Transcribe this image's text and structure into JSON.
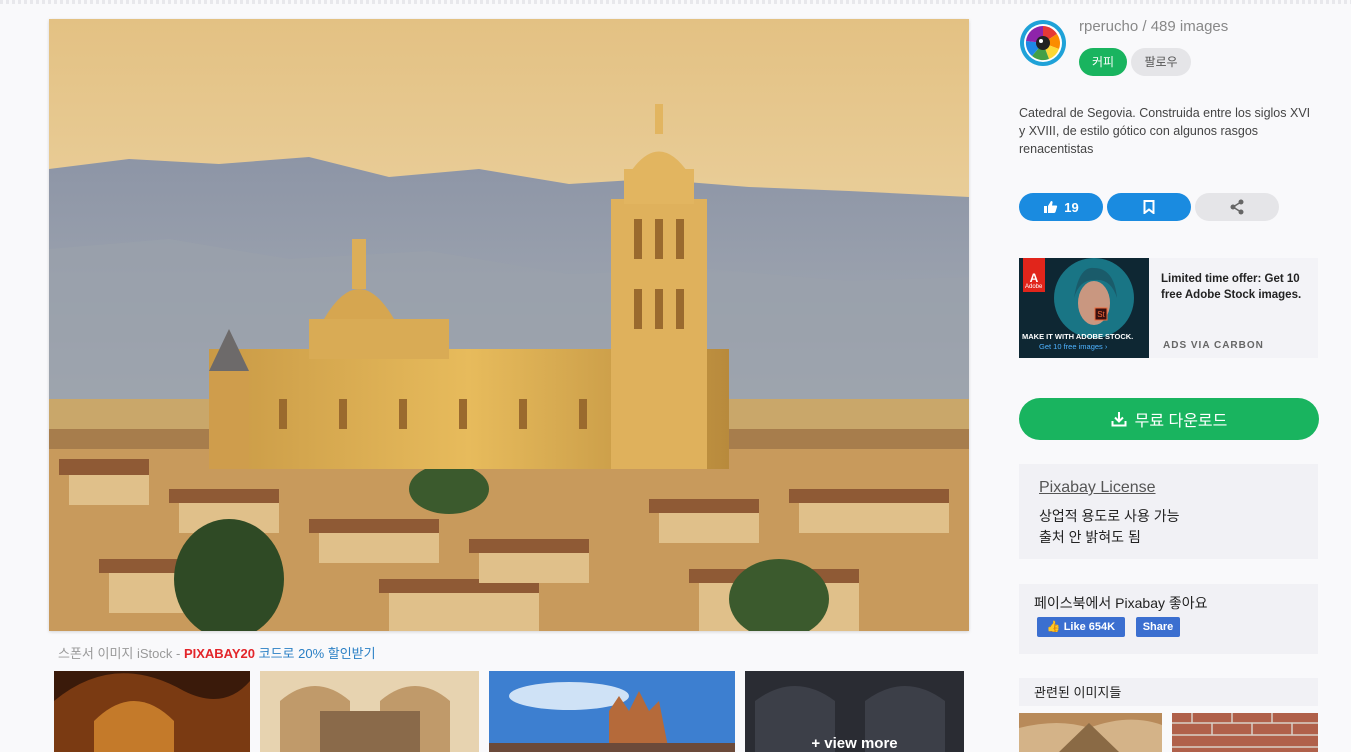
{
  "sponsor": {
    "prefix": "스폰서 이미지 iStock - ",
    "code": "PIXABAY20",
    "suffix": " 코드로 20% 할인받기"
  },
  "thumbnails": {
    "view_more": "+ view more"
  },
  "user": {
    "name_count": "rperucho / 489 images",
    "coffee_label": "커피",
    "follow_label": "팔로우"
  },
  "description": "Catedral de Segovia. Construida entre los siglos XVI y XVIII, de estilo gótico con algunos rasgos renacentistas",
  "actions": {
    "like_count": "19"
  },
  "ad": {
    "headline": "MAKE IT WITH ADOBE STOCK.",
    "cta": "Get 10 free images ›",
    "text": "Limited time offer: Get 10 free Adobe Stock images.",
    "via": "ADS VIA CARBON",
    "brand": "Adobe",
    "app_badge": "St"
  },
  "download": {
    "label": "무료 다운로드"
  },
  "license": {
    "title": "Pixabay License",
    "line1": "상업적 용도로 사용 가능",
    "line2": "출처 안 밝혀도 됨"
  },
  "facebook": {
    "title": "페이스북에서 Pixabay 좋아요",
    "like_label": "Like 654K",
    "share_label": "Share"
  },
  "related": {
    "title": "관련된 이미지들"
  },
  "colors": {
    "green": "#19b45f",
    "blue": "#1a8be0",
    "red": "#e3252a"
  }
}
